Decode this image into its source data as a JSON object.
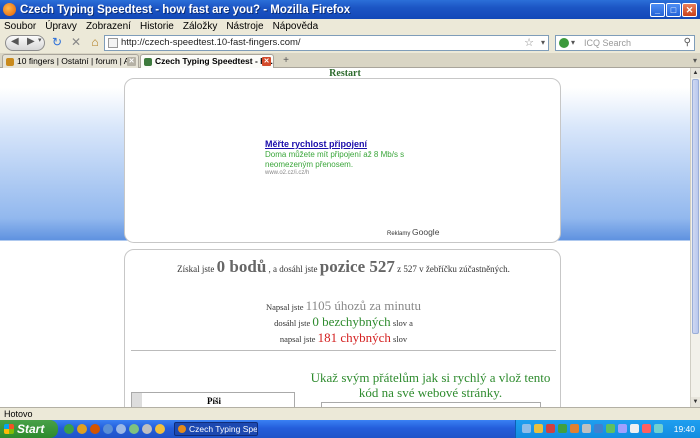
{
  "window": {
    "title": "Czech Typing Speedtest - how fast are you? - Mozilla Firefox",
    "minimize_label": "_",
    "maximize_label": "□",
    "close_label": "✕"
  },
  "menu": [
    "Soubor",
    "Úpravy",
    "Zobrazení",
    "Historie",
    "Záložky",
    "Nástroje",
    "Nápověda"
  ],
  "nav": {
    "url": "http://czech-speedtest.10-fast-fingers.com/",
    "search_placeholder": "ICQ Search"
  },
  "tabs": [
    {
      "label": "10 fingers | Ostatní | forum | A..."
    },
    {
      "label": "Czech Typing Speedtest - ho..."
    }
  ],
  "page": {
    "restart": "Restart",
    "ad": {
      "link": "Měřte rychlost připojení",
      "desc": "Doma můžete mít připojení až 8 Mb/s s neomezeným přenosem.",
      "url": "www.o2.cz/i.cz/h",
      "google_prefix": "Reklamy",
      "google_brand": "Google"
    },
    "result": {
      "got_prefix": "Získal jste",
      "points": "0 bodů",
      "reached_prefix": ", a dosáhl jste",
      "position": "pozice 527",
      "ranking_suffix": "z 527 v žebříčku zúčastněných.",
      "typed_prefix": "Napsal jste",
      "keystrokes": "1105 úhozů za minutu",
      "reached2": "dosáhl jste",
      "correct": "0 bezchybných",
      "words_and": "slov a",
      "typed2": "napsal jste",
      "wrong": "181 chybných",
      "words": "slov"
    },
    "write_label": "Píši",
    "share": "Ukaž svým přátelům jak si rychlý a vlož tento kód na své webové stránky."
  },
  "status": "Hotovo",
  "taskbar": {
    "start": "Start",
    "task": "Czech Typing Spe...",
    "clock": "19:40"
  }
}
